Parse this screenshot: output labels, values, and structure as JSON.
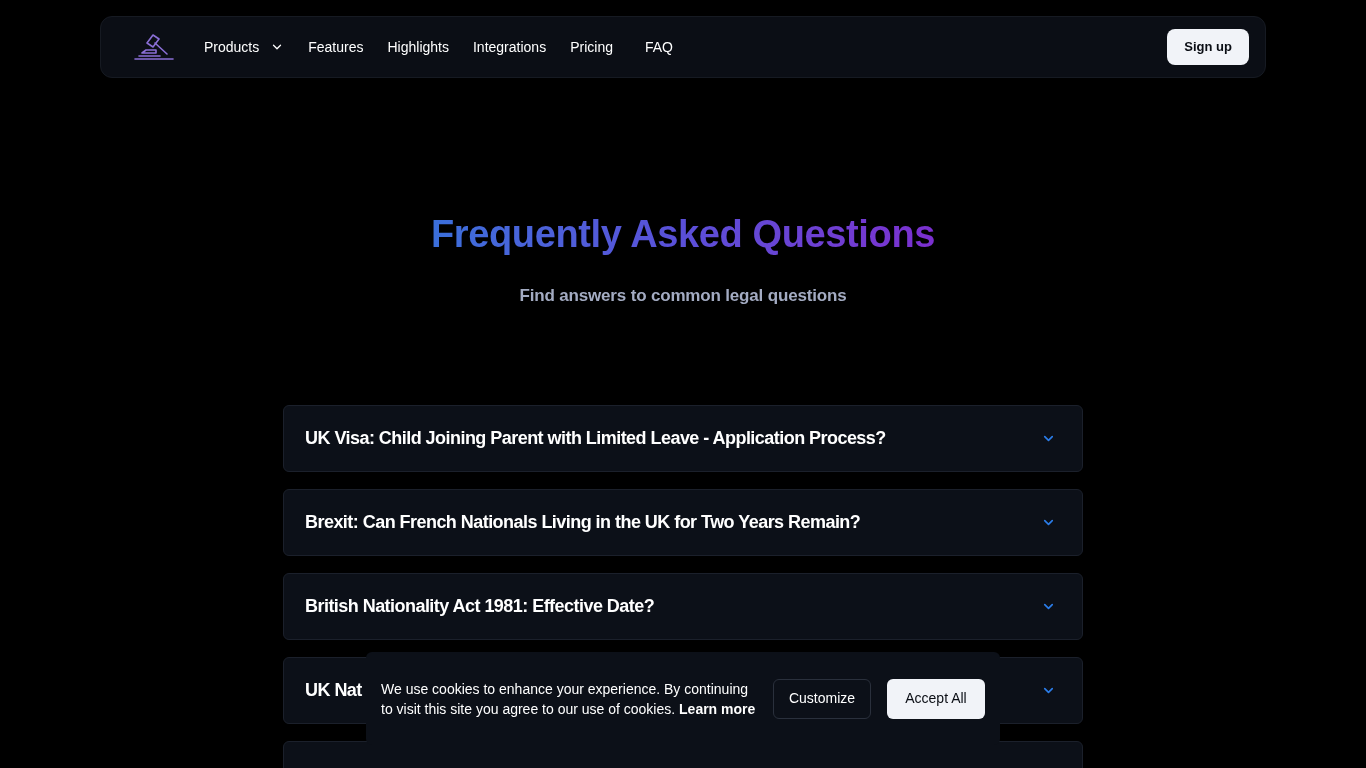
{
  "nav": {
    "items": [
      {
        "label": "Products",
        "kind": "dropdown"
      },
      {
        "label": "Features",
        "kind": "link"
      },
      {
        "label": "Highlights",
        "kind": "link"
      },
      {
        "label": "Integrations",
        "kind": "link"
      },
      {
        "label": "Pricing",
        "kind": "link"
      },
      {
        "label": "FAQ",
        "kind": "link"
      }
    ],
    "action": "Sign up"
  },
  "hero": {
    "title": "Frequently Asked Questions",
    "subtitle": "Find answers to common legal questions"
  },
  "faq": [
    {
      "question": "UK Visa: Child Joining Parent with Limited Leave - Application Process?",
      "expanded": false
    },
    {
      "question": "Brexit: Can French Nationals Living in the UK for Two Years Remain?",
      "expanded": false
    },
    {
      "question": "British Nationality Act 1981: Effective Date?",
      "expanded": false
    },
    {
      "question": "UK Nat",
      "expanded": false
    }
  ],
  "more_items_below": true,
  "cookie_banner": {
    "message": "We use cookies to enhance your experience. By continuing to visit this site you agree to our use of cookies.",
    "link": "Learn more",
    "buttons": [
      {
        "label": "Customize",
        "kind": "secondary"
      },
      {
        "label": "Accept All",
        "kind": "primary"
      }
    ]
  }
}
